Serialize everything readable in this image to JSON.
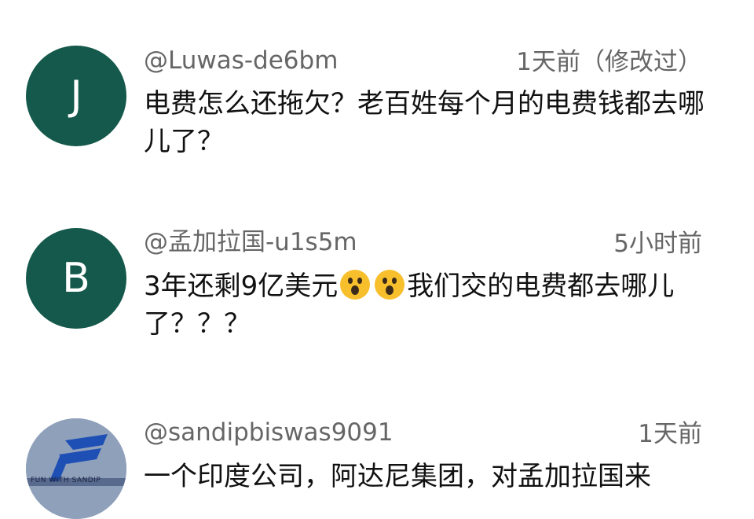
{
  "comments": [
    {
      "avatar_letter": "J",
      "username": "@Luwas-de6bm",
      "time": "1天前（修改过）",
      "text": "电费怎么还拖欠？老百姓每个月的电费钱都去哪儿了？"
    },
    {
      "avatar_letter": "B",
      "username": "@孟加拉国-u1s5m",
      "time": "5小时前",
      "text_before": "3年还剩9亿美元",
      "emoji_name": "astonished-face",
      "text_after": "我们交的电费都去哪儿了？？？"
    },
    {
      "avatar_logo_text": "FUN WITH SANDIP",
      "username": "@sandipbiswas9091",
      "time": "1天前",
      "text": "一个印度公司，阿达尼集团，对孟加拉国来"
    }
  ],
  "colors": {
    "avatar_green": "#14594b",
    "meta_gray": "#666666",
    "text_black": "#111111"
  }
}
